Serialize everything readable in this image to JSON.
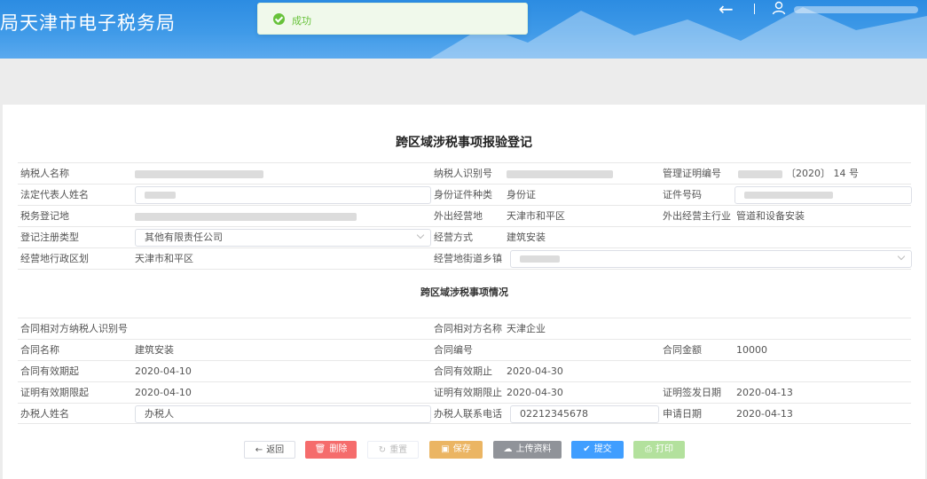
{
  "header": {
    "title": "局天津市电子税务局"
  },
  "toast": {
    "message": "成功"
  },
  "form": {
    "title": "跨区域涉税事项报验登记",
    "section_title": "跨区域涉税事项情况",
    "labels": {
      "taxpayer_name": "纳税人名称",
      "taxpayer_id": "纳税人识别号",
      "mgmt_cert_no": "管理证明编号",
      "legal_rep": "法定代表人姓名",
      "id_type": "身份证件种类",
      "id_no": "证件号码",
      "tax_reg_place": "税务登记地",
      "out_place": "外出经营地",
      "out_industry": "外出经营主行业",
      "reg_type": "登记注册类型",
      "biz_mode": "经营方式",
      "biz_district": "经营地行政区划",
      "biz_street": "经营地街道乡镇",
      "counterparty_id": "合同相对方纳税人识别号",
      "counterparty_name": "合同相对方名称",
      "contract_name": "合同名称",
      "contract_no": "合同编号",
      "contract_amount": "合同金额",
      "contract_start": "合同有效期起",
      "contract_end": "合同有效期止",
      "cert_start": "证明有效期限起",
      "cert_end": "证明有效期限止",
      "cert_issue": "证明签发日期",
      "handler_name": "办税人姓名",
      "handler_phone": "办税人联系电话",
      "apply_date": "申请日期"
    },
    "values": {
      "mgmt_cert_no_suffix": "〔2020〕 14 号",
      "id_type": "身份证",
      "out_place": "天津市和平区",
      "out_industry": "管道和设备安装",
      "reg_type": "其他有限责任公司",
      "biz_mode": "建筑安装",
      "biz_district": "天津市和平区",
      "counterparty_name": "天津企业",
      "contract_name": "建筑安装",
      "contract_amount": "10000",
      "contract_start": "2020-04-10",
      "contract_end": "2020-04-30",
      "cert_start": "2020-04-10",
      "cert_end": "2020-04-30",
      "cert_issue": "2020-04-13",
      "handler_name": "办税人",
      "handler_phone": "02212345678",
      "apply_date": "2020-04-13"
    }
  },
  "buttons": {
    "back": "返回",
    "delete": "删除",
    "reset": "重置",
    "save": "保存",
    "upload": "上传资料",
    "submit": "提交",
    "print": "打印"
  },
  "colors": {
    "header_blue": "#3f9ae8",
    "success_green": "#67c23a",
    "delete_red": "#f56c6c",
    "save_orange": "#e6a23c",
    "upload_gray": "#909399",
    "submit_blue": "#409eff",
    "print_green": "#b3e19d"
  }
}
